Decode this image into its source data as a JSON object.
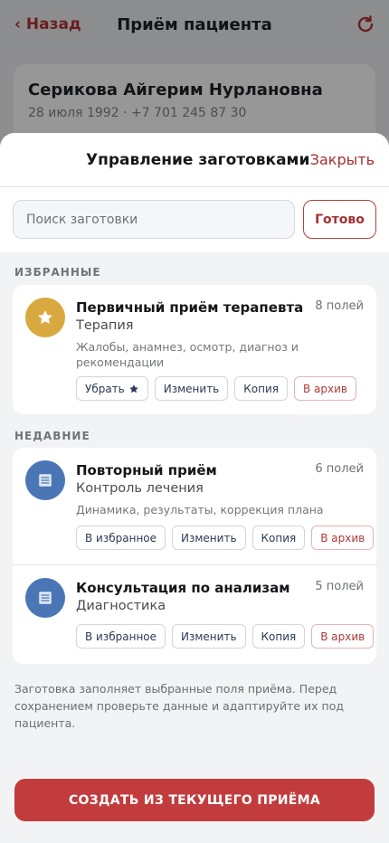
{
  "background": {
    "nav": {
      "back_label": "‹ Назад",
      "title": "Приём пациента",
      "refresh_icon": "refresh-icon"
    },
    "patient": {
      "name": "Серикова Айгерим Нурлановна",
      "meta": "28 июля 1992 · +7 701 245 87 30"
    }
  },
  "sheet": {
    "title": "Управление заготовками",
    "close_label": "Закрыть",
    "search_placeholder": "Поиск заготовки",
    "search_value": "",
    "done_label": "Готово",
    "favorites_label": "ИЗБРАННЫЕ",
    "recent_label": "НЕДАВНИЕ",
    "favorites": [
      {
        "title": "Первичный приём терапевта",
        "count": "8 полей",
        "category": "Терапия",
        "description": "Жалобы, анамнез, осмотр, диагноз и рекомендации",
        "actions": {
          "unfav": "Убрать",
          "edit": "Изменить",
          "copy": "Копия",
          "archive": "В архив"
        }
      }
    ],
    "recent": [
      {
        "title": "Повторный приём",
        "count": "6 полей",
        "category": "Контроль лечения",
        "description": "Динамика, результаты, коррекция плана",
        "actions": {
          "fav": "В избранное",
          "edit": "Изменить",
          "copy": "Копия",
          "archive": "В архив"
        }
      },
      {
        "title": "Консультация по анализам",
        "count": "5 полей",
        "category": "Диагностика",
        "description": "",
        "actions": {
          "fav": "В избранное",
          "edit": "Изменить",
          "copy": "Копия",
          "archive": "В архив"
        }
      }
    ],
    "note": "Заготовка заполняет выбранные поля приёма. Перед сохранением проверьте данные и адаптируйте их под пациента.",
    "create_label": "СОЗДАТЬ ИЗ ТЕКУЩЕГО ПРИЁМА"
  },
  "colors": {
    "accent": "#a5302f",
    "primary_button": "#c23c3d",
    "favorite_icon": "#d9a93f",
    "doc_icon": "#4b76b6"
  }
}
